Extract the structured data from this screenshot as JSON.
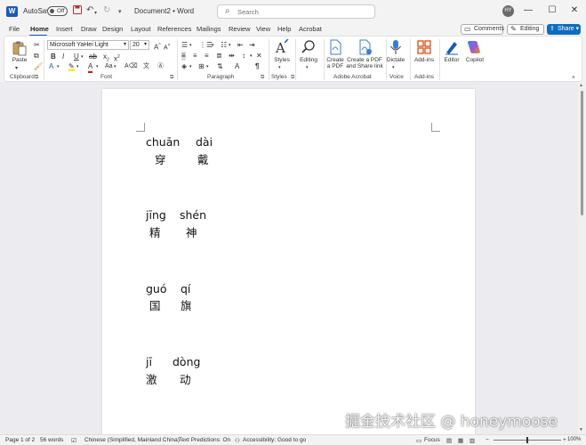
{
  "titlebar": {
    "autosave_label": "AutoSave",
    "autosave_state": "Off",
    "doc_title": "Document2 • Word",
    "search_placeholder": "Search",
    "avatar_initials": "HY"
  },
  "tabs": [
    "File",
    "Home",
    "Insert",
    "Draw",
    "Design",
    "Layout",
    "References",
    "Mailings",
    "Review",
    "View",
    "Help",
    "Acrobat"
  ],
  "active_tab": "Home",
  "right_buttons": {
    "comments": "Comments",
    "editing": "Editing",
    "share": "Share"
  },
  "ribbon": {
    "clipboard": {
      "paste": "Paste",
      "label": "Clipboard"
    },
    "font": {
      "name": "Microsoft YaHei Light",
      "size": "20",
      "label": "Font"
    },
    "paragraph": {
      "label": "Paragraph"
    },
    "styles": {
      "button": "Styles",
      "label": "Styles"
    },
    "editing": {
      "button": "Editing"
    },
    "acrobat": {
      "create_pdf_1": "Create",
      "create_pdf_2": "a PDF",
      "share_pdf_1": "Create a PDF",
      "share_pdf_2": "and Share link",
      "label": "Adobe Acrobat"
    },
    "voice": {
      "dictate": "Dictate",
      "label": "Voice"
    },
    "addins": {
      "button": "Add-ins",
      "label": "Add-ins"
    },
    "editor": "Editor",
    "copilot": "Copilot"
  },
  "document": {
    "entries": [
      {
        "pinyin": [
          "chuān",
          "dài"
        ],
        "hanzi": [
          "穿",
          "戴"
        ]
      },
      {
        "pinyin": [
          "jīng",
          "shén"
        ],
        "hanzi": [
          "精",
          "神"
        ]
      },
      {
        "pinyin": [
          "guó",
          "qí"
        ],
        "hanzi": [
          "国",
          "旗"
        ]
      },
      {
        "pinyin": [
          "jī",
          "dòng"
        ],
        "hanzi": [
          "激",
          "动"
        ]
      }
    ]
  },
  "status": {
    "page": "Page 1 of 2",
    "words": "56 words",
    "language": "Chinese (Simplified, Mainland China)",
    "predictions": "Text Predictions: On",
    "accessibility": "Accessibility: Good to go",
    "focus": "Focus",
    "zoom": "100%"
  },
  "watermark": "掘金技术社区 @ honeymoose"
}
